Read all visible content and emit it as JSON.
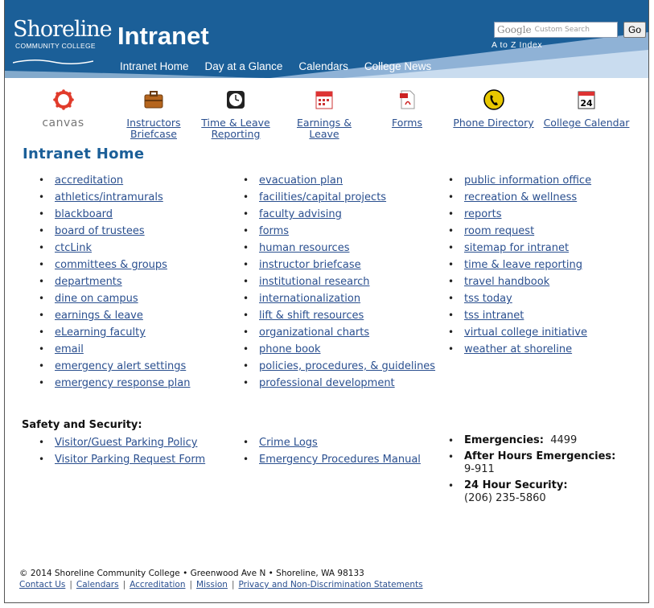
{
  "header": {
    "logo_line1": "Shoreline",
    "logo_line2": "COMMUNITY COLLEGE",
    "site_title": "Intranet",
    "nav": [
      "Intranet Home",
      "Day at a Glance",
      "Calendars",
      "College News"
    ],
    "search_brand": "Google",
    "search_placeholder": "Custom Search",
    "go_label": "Go",
    "az_index": "A to Z Index",
    "colors": {
      "header_bg": "#1b5f98",
      "link": "#2a4f8f"
    }
  },
  "quicklinks": [
    {
      "label": "canvas",
      "icon": "canvas-icon"
    },
    {
      "label_line1": "Instructors",
      "label_line2": "Briefcase",
      "icon": "briefcase-icon"
    },
    {
      "label_line1": "Time & Leave",
      "label_line2": "Reporting",
      "icon": "clock-icon"
    },
    {
      "label_line1": "Earnings &",
      "label_line2": "Leave",
      "icon": "calendar-icon"
    },
    {
      "label": "Forms",
      "icon": "pdf-icon"
    },
    {
      "label": "Phone Directory",
      "icon": "phone-icon"
    },
    {
      "label": "College Calendar",
      "icon": "calendar-24-icon"
    }
  ],
  "main": {
    "title": "Intranet Home",
    "col1": [
      "accreditation",
      "athletics/intramurals",
      "blackboard",
      "board of trustees",
      "ctcLink",
      "committees & groups",
      "departments",
      "dine on campus",
      "earnings & leave",
      "eLearning faculty",
      "email",
      "emergency alert settings",
      "emergency response plan"
    ],
    "col2": [
      "evacuation plan",
      "facilities/capital projects",
      "faculty advising",
      "forms",
      "human resources",
      "instructor briefcase",
      "institutional research",
      "internationalization",
      "lift & shift resources",
      "organizational charts",
      "phone book",
      "policies, procedures, & guidelines",
      "professional development"
    ],
    "col3": [
      "public information office",
      "recreation & wellness",
      "reports",
      "room request",
      "sitemap for intranet",
      "time & leave reporting",
      "travel handbook",
      "tss today",
      "tss intranet",
      "virtual college initiative",
      "weather at shoreline"
    ]
  },
  "safety": {
    "heading": "Safety and Security:",
    "col1": [
      "Visitor/Guest Parking Policy",
      "Visitor Parking Request Form"
    ],
    "col2": [
      "Crime Logs",
      "Emergency Procedures Manual"
    ],
    "contacts": [
      {
        "label": "Emergencies:",
        "value": "4499"
      },
      {
        "label": "After Hours Emergencies:",
        "value": "9-911"
      },
      {
        "label": "24 Hour Security:",
        "value": "(206) 235-5860"
      }
    ]
  },
  "footer": {
    "copyright": "© 2014 Shoreline Community College • Greenwood Ave N • Shoreline, WA 98133",
    "links": [
      "Contact Us",
      "Calendars",
      "Accreditation",
      "Mission",
      "Privacy and Non-Discrimination Statements"
    ]
  }
}
